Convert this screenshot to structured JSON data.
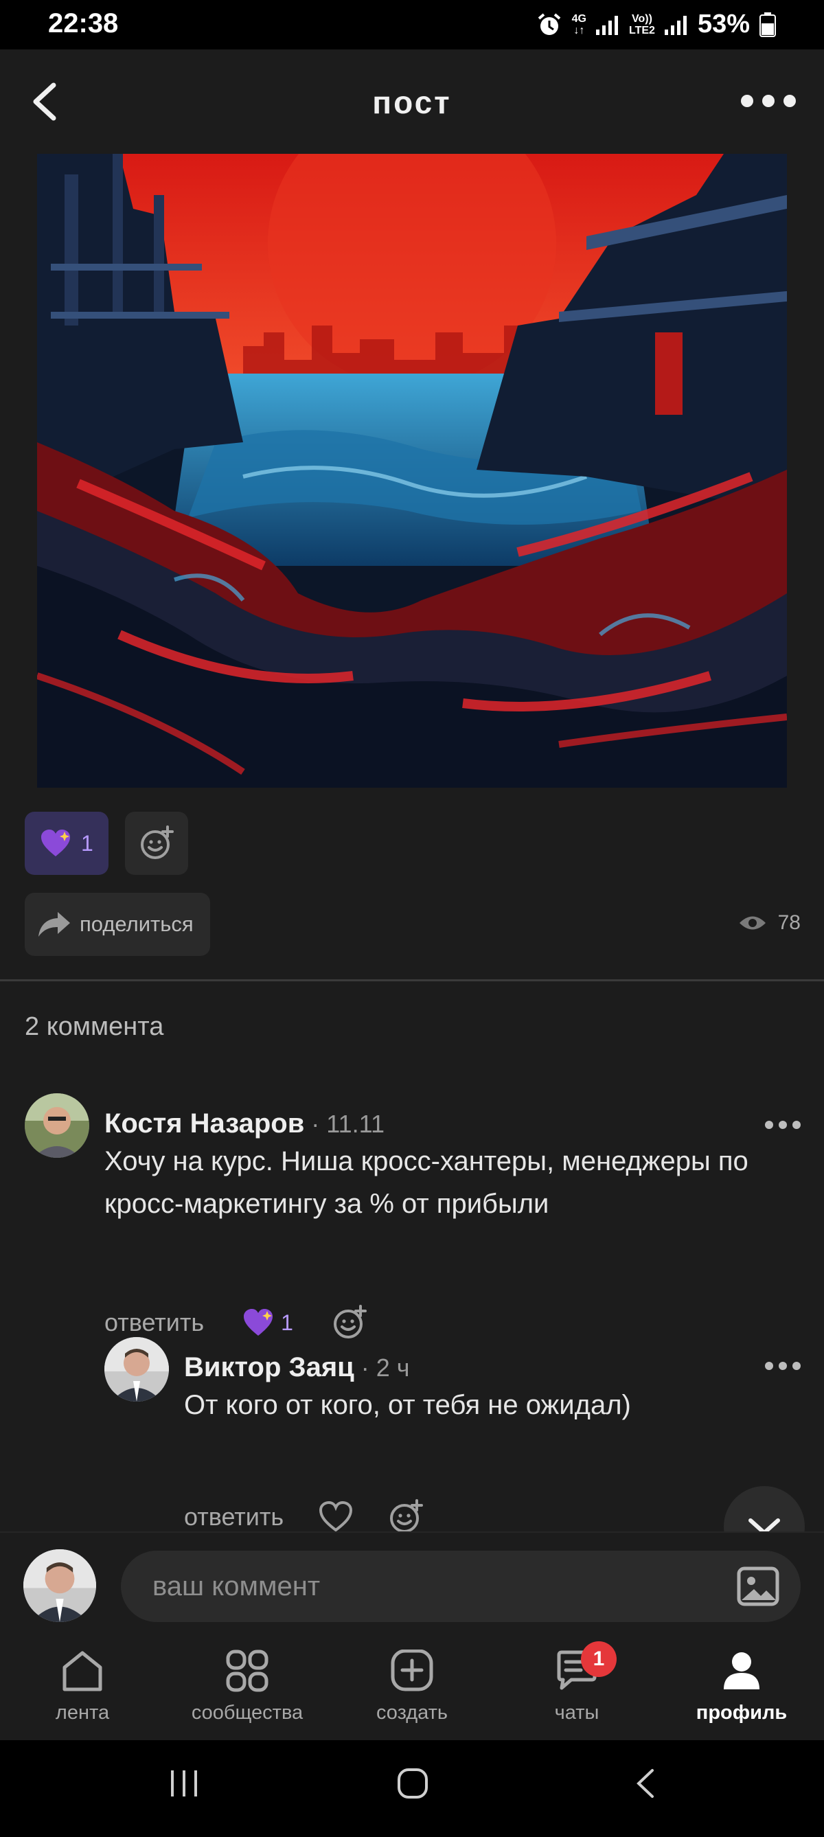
{
  "status_bar": {
    "time": "22:38",
    "net_top": "4G",
    "net_bottom": "↓↑",
    "volte_top": "Vo))",
    "volte_bottom": "LTE2",
    "battery": "53%"
  },
  "header": {
    "title": "пост"
  },
  "post": {
    "reaction_count": "1",
    "share_label": "поделиться",
    "views": "78"
  },
  "comments": {
    "count_label": "2 коммента",
    "items": [
      {
        "author": "Костя Назаров",
        "meta": " · 11.11",
        "text": "Хочу на курс. Ниша кросс-хантеры, менеджеры по кросс-маркетингу за % от прибыли",
        "reply_label": "ответить",
        "reaction_count": "1"
      },
      {
        "author": "Виктор Заяц",
        "meta": " · 2 ч",
        "text": "От кого от кого, от тебя не ожидал)",
        "reply_label": "ответить"
      }
    ]
  },
  "composer": {
    "placeholder": "ваш коммент"
  },
  "tabs": [
    {
      "label": "лента",
      "icon": "home-icon"
    },
    {
      "label": "сообщества",
      "icon": "grid-icon"
    },
    {
      "label": "создать",
      "icon": "plus-square-icon"
    },
    {
      "label": "чаты",
      "icon": "chat-icon",
      "badge": "1"
    },
    {
      "label": "профиль",
      "icon": "user-icon"
    }
  ],
  "colors": {
    "background": "#1c1c1c",
    "accent_purple": "#b79aff",
    "badge_red": "#e5373a"
  }
}
